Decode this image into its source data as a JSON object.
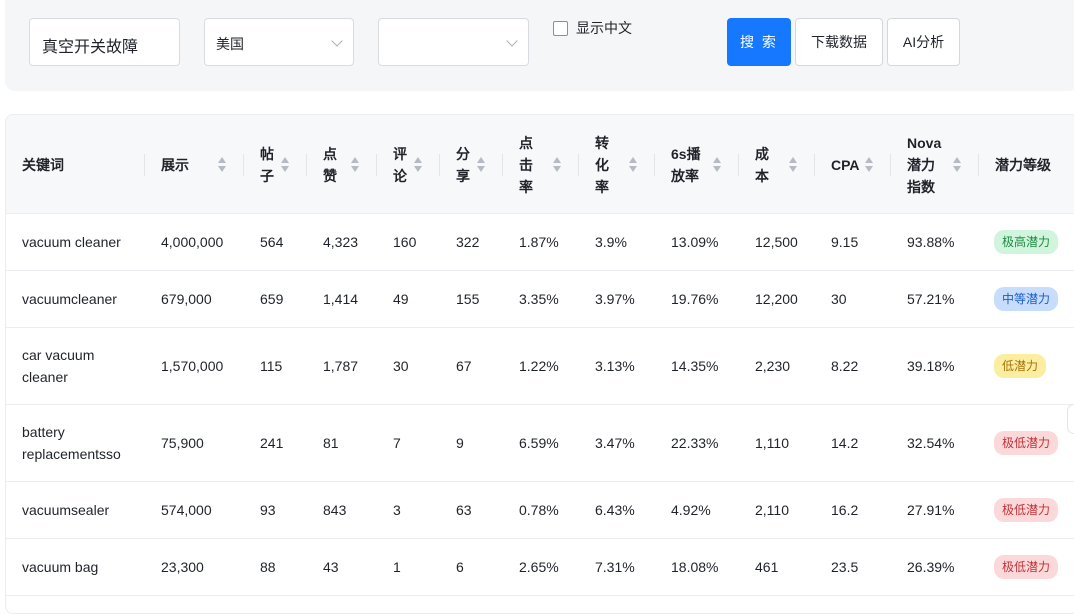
{
  "filters": {
    "keyword_value": "真空开关故障",
    "country_value": "美国",
    "second_select_value": "",
    "show_chinese_label": "显示中文",
    "show_chinese_checked": false
  },
  "buttons": {
    "search_label": "搜 索",
    "download_label": "下载数据",
    "ai_label": "AI分析"
  },
  "colors": {
    "primary": "#1677ff",
    "badge_very_high": "#d1f5dc",
    "badge_medium": "#c8dcfc",
    "badge_low": "#fbeea0",
    "badge_very_low": "#fbd9db"
  },
  "table": {
    "headers": {
      "keyword": "关键词",
      "impressions": "展示",
      "posts_l1": "帖",
      "posts_l2": "子",
      "likes_l1": "点",
      "likes_l2": "赞",
      "comments_l1": "评",
      "comments_l2": "论",
      "shares_l1": "分",
      "shares_l2": "享",
      "ctr_l1": "点",
      "ctr_l2": "击",
      "ctr_l3": "率",
      "cvr_l1": "转",
      "cvr_l2": "化",
      "cvr_l3": "率",
      "play6s_l1": "6s播",
      "play6s_l2": "放率",
      "cost_l1": "成",
      "cost_l2": "本",
      "cpa": "CPA",
      "nova_l1": "Nova",
      "nova_l2": "潜力",
      "nova_l3": "指数",
      "potential": "潜力等级"
    },
    "rows": [
      {
        "kw1": "vacuum cleaner",
        "kw2": "",
        "impressions": "4,000,000",
        "posts": "564",
        "likes": "4,323",
        "comments": "160",
        "shares": "322",
        "ctr": "1.87%",
        "cvr": "3.9%",
        "play6s": "13.09%",
        "cost": "12,500",
        "cpa": "9.15",
        "nova": "93.88%",
        "potential": "极高潜力",
        "level": "very-high"
      },
      {
        "kw1": "vacuumcleaner",
        "kw2": "",
        "impressions": "679,000",
        "posts": "659",
        "likes": "1,414",
        "comments": "49",
        "shares": "155",
        "ctr": "3.35%",
        "cvr": "3.97%",
        "play6s": "19.76%",
        "cost": "12,200",
        "cpa": "30",
        "nova": "57.21%",
        "potential": "中等潜力",
        "level": "medium"
      },
      {
        "kw1": "car vacuum",
        "kw2": "cleaner",
        "impressions": "1,570,000",
        "posts": "115",
        "likes": "1,787",
        "comments": "30",
        "shares": "67",
        "ctr": "1.22%",
        "cvr": "3.13%",
        "play6s": "14.35%",
        "cost": "2,230",
        "cpa": "8.22",
        "nova": "39.18%",
        "potential": "低潜力",
        "level": "low"
      },
      {
        "kw1": "battery",
        "kw2": "replacementsso",
        "impressions": "75,900",
        "posts": "241",
        "likes": "81",
        "comments": "7",
        "shares": "9",
        "ctr": "6.59%",
        "cvr": "3.47%",
        "play6s": "22.33%",
        "cost": "1,110",
        "cpa": "14.2",
        "nova": "32.54%",
        "potential": "极低潜力",
        "level": "very-low"
      },
      {
        "kw1": "vacuumsealer",
        "kw2": "",
        "impressions": "574,000",
        "posts": "93",
        "likes": "843",
        "comments": "3",
        "shares": "63",
        "ctr": "0.78%",
        "cvr": "6.43%",
        "play6s": "4.92%",
        "cost": "2,110",
        "cpa": "16.2",
        "nova": "27.91%",
        "potential": "极低潜力",
        "level": "very-low"
      },
      {
        "kw1": "vacuum bag",
        "kw2": "",
        "impressions": "23,300",
        "posts": "88",
        "likes": "43",
        "comments": "1",
        "shares": "6",
        "ctr": "2.65%",
        "cvr": "7.31%",
        "play6s": "18.08%",
        "cost": "461",
        "cpa": "23.5",
        "nova": "26.39%",
        "potential": "极低潜力",
        "level": "very-low"
      }
    ]
  }
}
